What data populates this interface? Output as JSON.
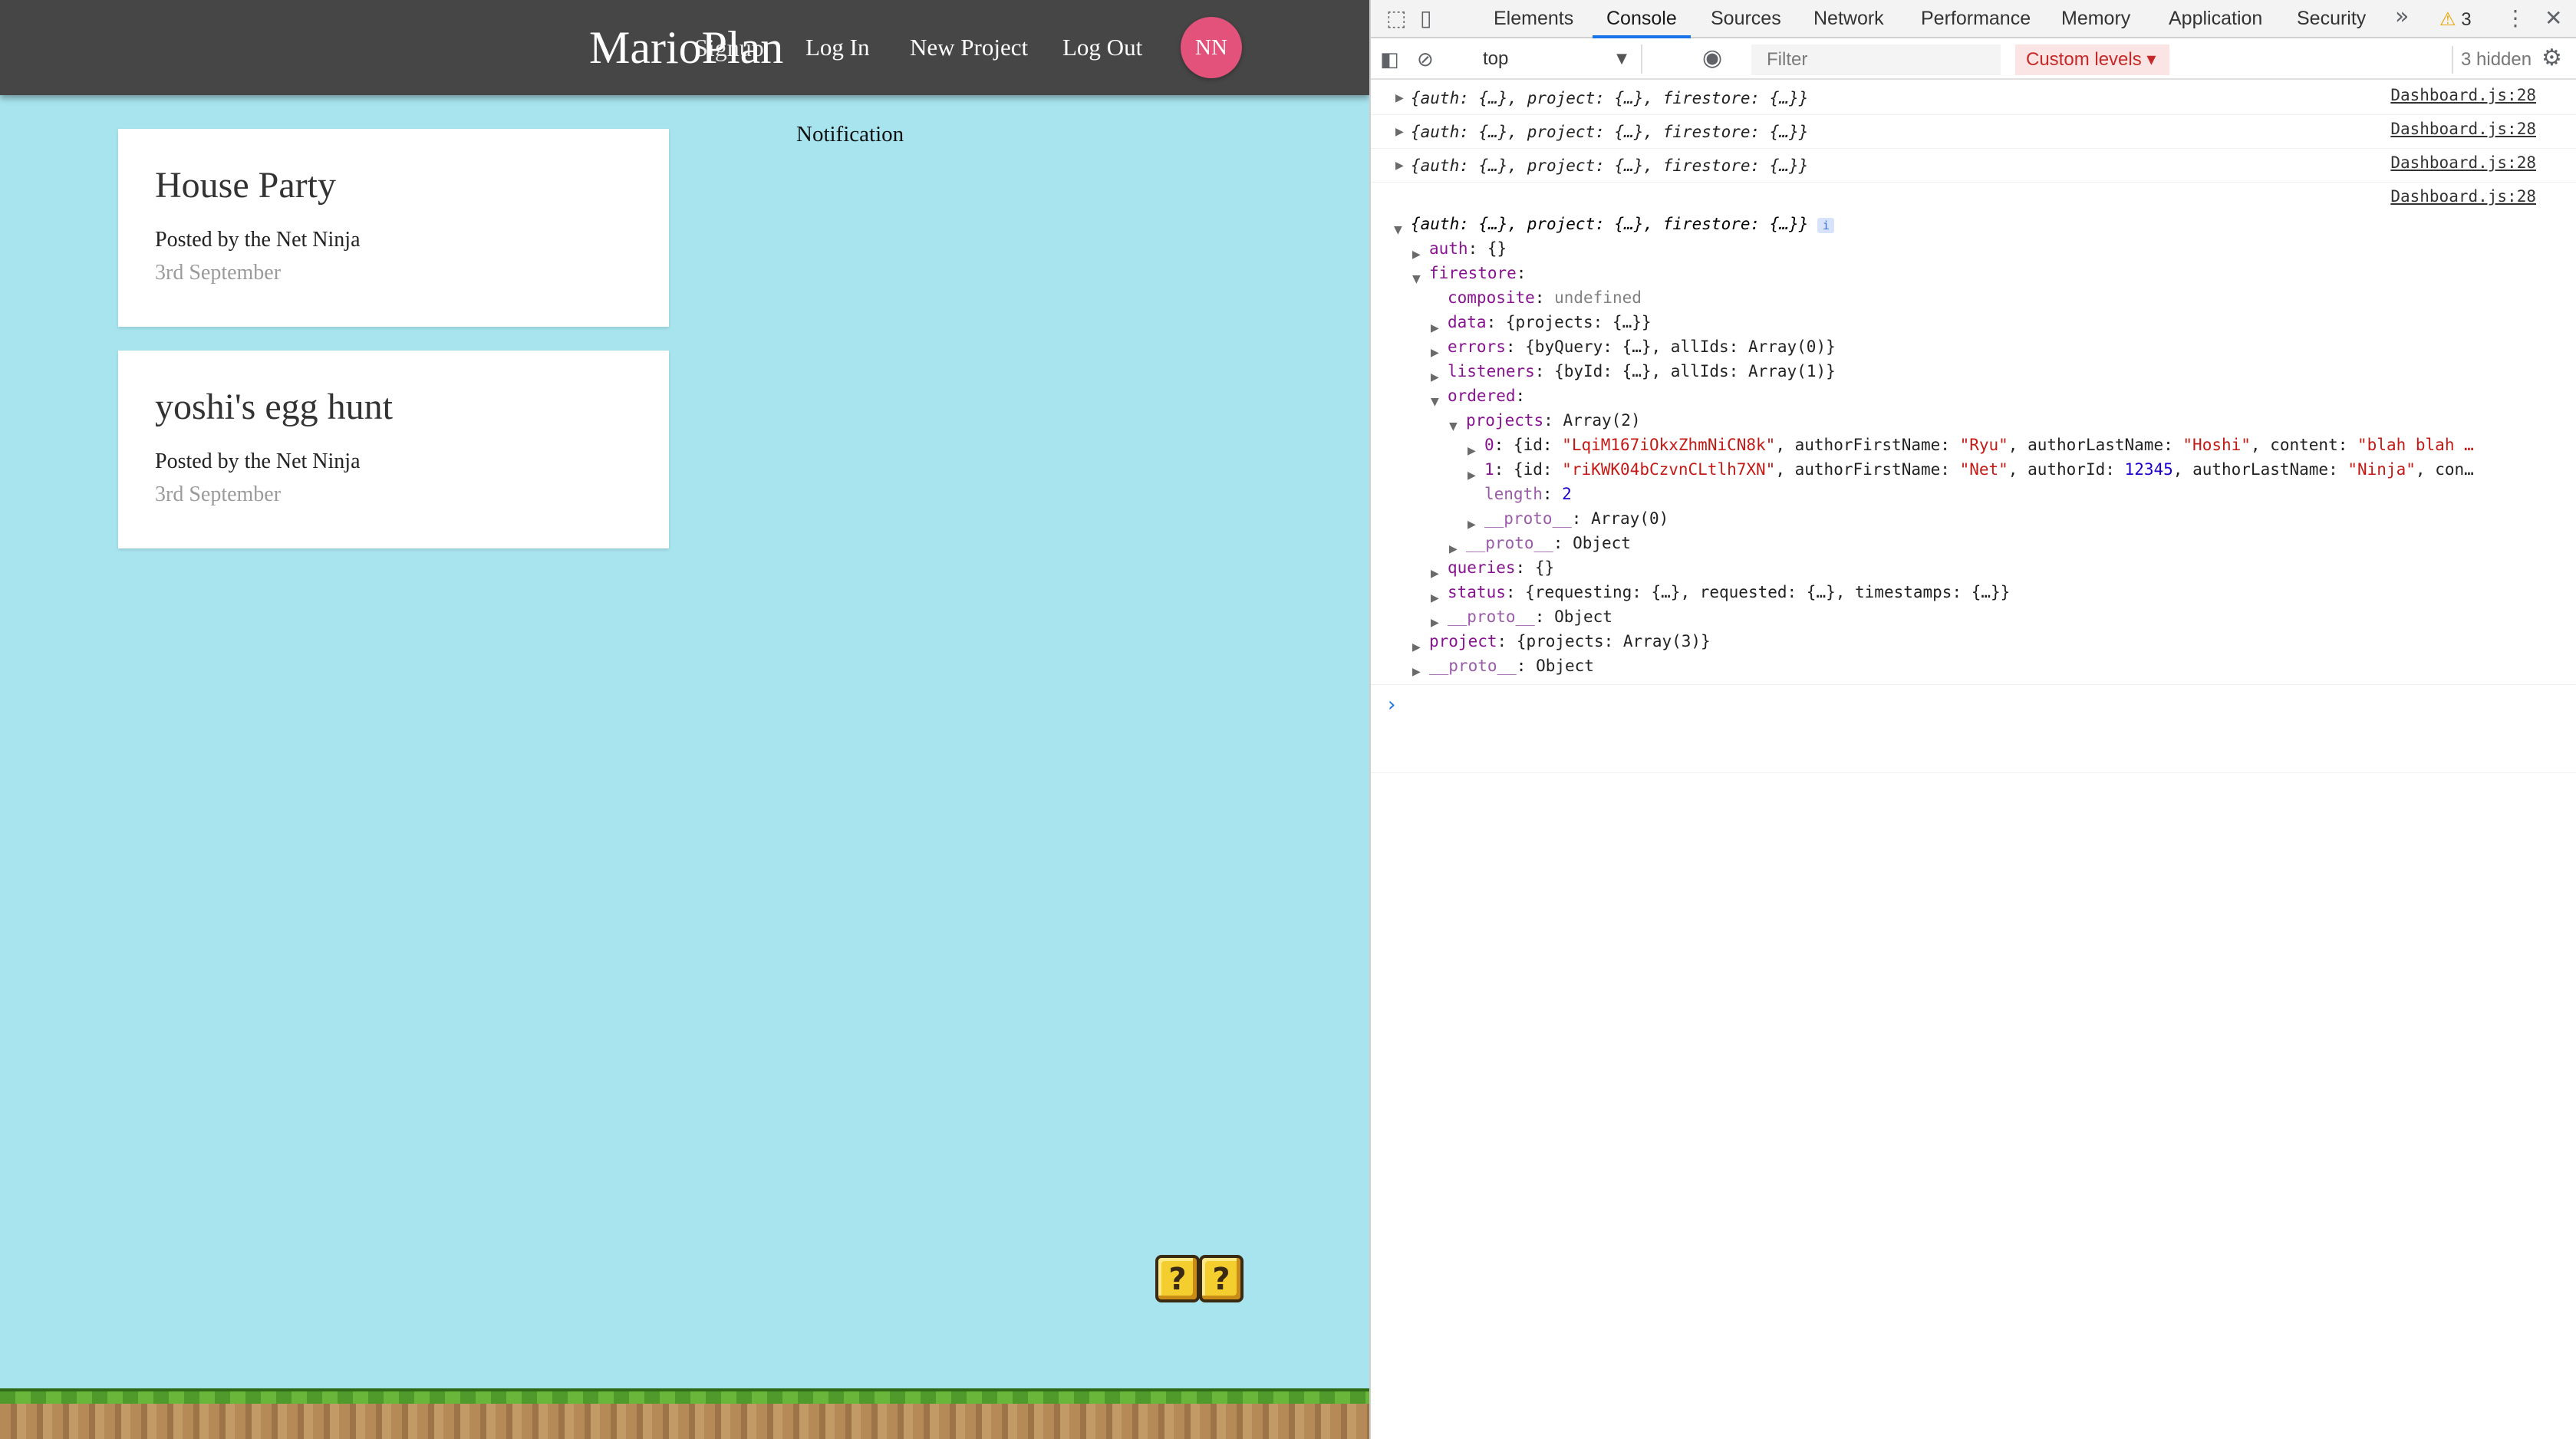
{
  "app": {
    "brand": "MarioPlan",
    "brand_overlap": "Signup",
    "nav": {
      "login": "Log In",
      "new_project": "New Project",
      "logout": "Log Out",
      "avatar_initials": "NN"
    },
    "projects": [
      {
        "title": "House Party",
        "author": "Posted by the Net Ninja",
        "date": "3rd September"
      },
      {
        "title": "yoshi's egg hunt",
        "author": "Posted by the Net Ninja",
        "date": "3rd September"
      }
    ],
    "notification_heading": "Notification",
    "question_block_glyph": "?"
  },
  "devtools": {
    "tabs": [
      "Elements",
      "Console",
      "Sources",
      "Network",
      "Performance",
      "Memory",
      "Application",
      "Security"
    ],
    "active_tab": "Console",
    "warning_count": "3",
    "toolbar": {
      "context": "top",
      "filter_placeholder": "Filter",
      "levels": "Custom levels",
      "hidden": "3 hidden"
    },
    "log_summary": "{auth: {…}, project: {…}, firestore: {…}}",
    "log_source": "Dashboard.js:28",
    "tree": {
      "auth_key": "auth",
      "auth_val": "{}",
      "firestore_key": "firestore",
      "composite_key": "composite",
      "composite_val": "undefined",
      "data_key": "data",
      "data_val": "{projects: {…}}",
      "errors_key": "errors",
      "errors_val": "{byQuery: {…}, allIds: Array(0)}",
      "listeners_key": "listeners",
      "listeners_val": "{byId: {…}, allIds: Array(1)}",
      "ordered_key": "ordered",
      "projects_key": "projects",
      "projects_val": "Array(2)",
      "item0": {
        "index": "0",
        "prefix": "{id: ",
        "id": "\"LqiM167iOkxZhmNiCN8k\"",
        "k1": "authorFirstName",
        "v1": "\"Ryu\"",
        "k2": "authorLastName",
        "v2": "\"Hoshi\"",
        "k3": "content",
        "v3": "\"blah blah …"
      },
      "item1": {
        "index": "1",
        "prefix": "{id: ",
        "id": "\"riKWK04bCzvnCLtlh7XN\"",
        "k1": "authorFirstName",
        "v1": "\"Net\"",
        "k2": "authorId",
        "v2": "12345",
        "k3": "authorLastName",
        "v3": "\"Ninja\"",
        "tail": "con…"
      },
      "length_key": "length",
      "length_val": "2",
      "proto_key": "__proto__",
      "proto_array_val": "Array(0)",
      "proto_object_val": "Object",
      "queries_key": "queries",
      "queries_val": "{}",
      "status_key": "status",
      "status_val": "{requesting: {…}, requested: {…}, timestamps: {…}}",
      "project_key": "project",
      "project_val": "{projects: Array(3)}"
    },
    "prompt": "›"
  },
  "colors": {
    "app_bg": "#a8e4ee",
    "navbar_bg": "#464646",
    "avatar_bg": "#e2527a",
    "devtools_accent": "#1a73e8"
  },
  "icons": [
    "inspect-icon",
    "device-toggle-icon",
    "more-tabs-icon",
    "warning-icon",
    "kebab-menu-icon",
    "close-icon",
    "sidebar-toggle-icon",
    "clear-console-icon",
    "chevron-down-icon",
    "eye-icon",
    "settings-gear-icon",
    "info-icon",
    "expand-triangle-icon",
    "question-block-icon"
  ]
}
